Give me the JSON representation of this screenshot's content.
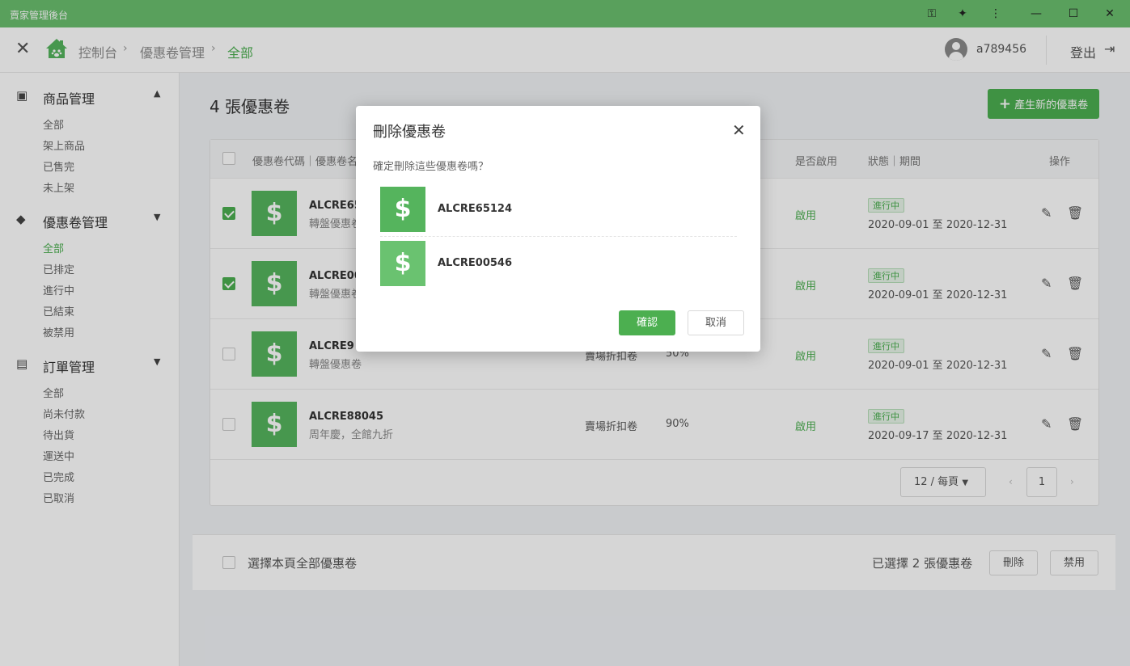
{
  "window": {
    "title": "賣家管理後台"
  },
  "header": {
    "breadcrumbs": [
      "控制台",
      "優惠卷管理",
      "全部"
    ],
    "username": "a789456",
    "logout_label": "登出"
  },
  "sidebar": {
    "groups": [
      {
        "label": "商品管理",
        "items": [
          "全部",
          "架上商品",
          "已售完",
          "未上架"
        ]
      },
      {
        "label": "優惠卷管理",
        "items": [
          "全部",
          "已排定",
          "進行中",
          "已結束",
          "被禁用"
        ],
        "active_index": 0
      },
      {
        "label": "訂單管理",
        "items": [
          "全部",
          "尚未付款",
          "待出貨",
          "運送中",
          "已完成",
          "已取消"
        ]
      }
    ]
  },
  "content": {
    "title": "4 張優惠卷",
    "new_button": "產生新的優惠卷"
  },
  "table": {
    "headers": {
      "code": "優惠卷代碼｜優惠卷名",
      "enabled": "是否啟用",
      "status": "狀態｜期間",
      "actions": "操作"
    },
    "rows": [
      {
        "checked": true,
        "code": "ALCRE65124",
        "code_visible": "ALCRE65",
        "desc": "轉盤優惠卷",
        "desc_visible": "轉盤優惠卷",
        "type": "",
        "discount": "",
        "enabled": "啟用",
        "status": "進行中",
        "period": "2020-09-01 至 2020-12-31"
      },
      {
        "checked": true,
        "code": "ALCRE00546",
        "code_visible": "ALCRE00",
        "desc": "轉盤優惠卷",
        "desc_visible": "轉盤優惠卷",
        "type": "",
        "discount": "",
        "enabled": "啟用",
        "status": "進行中",
        "period": "2020-09-01 至 2020-12-31"
      },
      {
        "checked": false,
        "code": "ALCRE9",
        "code_visible": "ALCRE9",
        "desc": "轉盤優惠卷",
        "desc_visible": "轉盤優惠卷",
        "type": "賣場折扣卷",
        "discount": "50%",
        "enabled": "啟用",
        "status": "進行中",
        "period": "2020-09-01 至 2020-12-31"
      },
      {
        "checked": false,
        "code": "ALCRE88045",
        "code_visible": "ALCRE88045",
        "desc": "周年慶，全館九折",
        "desc_visible": "周年慶，全館九折",
        "type": "賣場折扣卷",
        "discount": "90%",
        "enabled": "啟用",
        "status": "進行中",
        "period": "2020-09-17 至 2020-12-31"
      }
    ]
  },
  "pagination": {
    "page_size": "12 / 每頁",
    "current_page": "1"
  },
  "bottom_bar": {
    "select_all_label": "選擇本頁全部優惠卷",
    "selected_count_text": "已選擇 2 張優惠卷",
    "delete_button": "刪除",
    "disable_button": "禁用"
  },
  "modal": {
    "title": "刪除優惠卷",
    "message": "確定刪除這些優惠卷嗎？",
    "items": [
      "ALCRE65124",
      "ALCRE00546"
    ],
    "confirm_button": "確認",
    "cancel_button": "取消"
  },
  "colors": {
    "accent": "#4caf50",
    "titlebar": "#6abf6e"
  }
}
